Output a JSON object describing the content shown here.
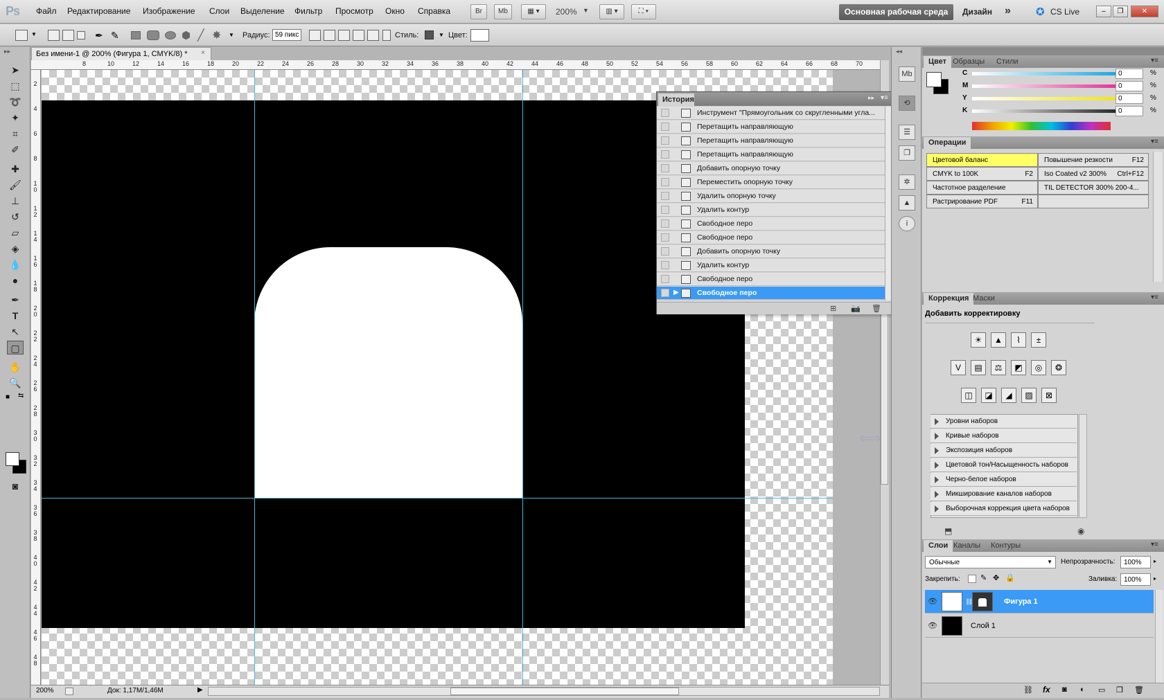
{
  "app": {
    "logo": "Ps",
    "workspace_label": "Основная рабочая среда",
    "design_label": "Дизайн",
    "more": "»",
    "cslive": "CS Live",
    "zoom_menu": "200%",
    "minimize": "–",
    "restore": "❐",
    "close": "✕"
  },
  "menu": [
    "Файл",
    "Редактирование",
    "Изображение",
    "Слои",
    "Выделение",
    "Фильтр",
    "Просмотр",
    "Окно",
    "Справка"
  ],
  "menubar_buttons": [
    "Br",
    "Mb"
  ],
  "options": {
    "radius_label": "Радиус:",
    "radius_value": "59 пикс",
    "style_label": "Стиль:",
    "color_label": "Цвет:",
    "color_value": "#ffffff",
    "style_color": "#555555"
  },
  "document": {
    "tab_title": "Без имени-1 @ 200% (Фигура 1, CMYK/8) *",
    "tab_close": "×",
    "zoom": "200%",
    "doc_info": "Док: 1,17M/1,46M",
    "ruler_h": [
      "8",
      "10",
      "12",
      "14",
      "16",
      "18",
      "20",
      "22",
      "24",
      "26",
      "28",
      "30",
      "32",
      "34",
      "36",
      "38",
      "40",
      "42",
      "44",
      "46",
      "48",
      "50",
      "52",
      "54",
      "56",
      "58",
      "60",
      "62",
      "64",
      "66",
      "68",
      "70"
    ],
    "ruler_v": [
      "2",
      "4",
      "6",
      "8",
      "1 0",
      "1 2",
      "1 4",
      "1 6",
      "1 8",
      "2 0",
      "2 2",
      "2 4",
      "2 6",
      "2 8",
      "3 0",
      "3 2",
      "3 4",
      "3 6",
      "3 8",
      "4 0",
      "4 2",
      "4 4",
      "4 6",
      "4 8"
    ],
    "canvas_color": "#000000",
    "shape_color": "#ffffff",
    "guide_color": "#4ab7d6"
  },
  "history": {
    "title": "История",
    "items": [
      "Инструмент \"Прямоугольник со скругленными угла...",
      "Перетащить направляющую",
      "Перетащить направляющую",
      "Перетащить направляющую",
      "Добавить опорную точку",
      "Переместить опорную точку",
      "Удалить опорную точку",
      "Удалить контур",
      "Свободное перо",
      "Свободное перо",
      "Добавить опорную точку",
      "Удалить контур",
      "Свободное перо",
      "Свободное перо"
    ],
    "selected_index": 13,
    "selected_color": "#3a9af5"
  },
  "color_panel": {
    "tabs": [
      "Цвет",
      "Образцы",
      "Стили"
    ],
    "channels": [
      {
        "label": "C",
        "value": "0",
        "unit": "%"
      },
      {
        "label": "M",
        "value": "0",
        "unit": "%"
      },
      {
        "label": "Y",
        "value": "0",
        "unit": "%"
      },
      {
        "label": "K",
        "value": "0",
        "unit": "%"
      }
    ]
  },
  "actions": {
    "title": "Операции",
    "items": [
      {
        "name": "Цветовой баланс",
        "key": ""
      },
      {
        "name": "Повышение резкости",
        "key": "F12"
      },
      {
        "name": "CMYK to 100K",
        "key": "F2"
      },
      {
        "name": "Iso Coated v2 300%",
        "key": "Ctrl+F12"
      },
      {
        "name": "Частотное разделение",
        "key": ""
      },
      {
        "name": "TIL DETECTOR 300% 200-4...",
        "key": ""
      },
      {
        "name": "Растрирование PDF",
        "key": "F11"
      },
      {
        "name": "",
        "key": ""
      }
    ],
    "highlight_color": "#ffff66"
  },
  "adjustments": {
    "tabs": [
      "Коррекция",
      "Маски"
    ],
    "heading": "Добавить корректировку",
    "presets": [
      "Уровни наборов",
      "Кривые наборов",
      "Экспозиция наборов",
      "Цветовой тон/Насыщенность наборов",
      "Черно-белое наборов",
      "Микширование каналов наборов",
      "Выборочная коррекция цвета наборов"
    ]
  },
  "layers": {
    "tabs": [
      "Слои",
      "Каналы",
      "Контуры"
    ],
    "blend_mode": "Обычные",
    "opacity_label": "Непрозрачность:",
    "opacity_value": "100%",
    "lock_label": "Закрепить:",
    "fill_label": "Заливка:",
    "fill_value": "100%",
    "items": [
      {
        "name": "Фигура 1",
        "selected": true
      },
      {
        "name": "Слой 1",
        "selected": false
      }
    ]
  }
}
